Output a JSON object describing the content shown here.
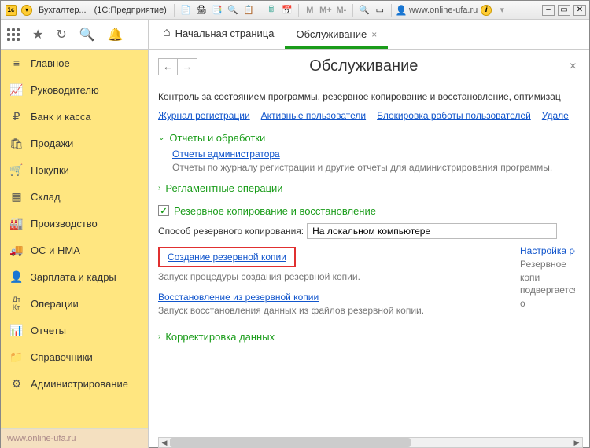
{
  "titlebar": {
    "app_title": "Бухгалтер...",
    "product": "(1С:Предприятие)",
    "url": "www.online-ufa.ru",
    "m_icons": [
      "M",
      "M+",
      "M-"
    ]
  },
  "tabs": {
    "home_label": "Начальная страница",
    "active_label": "Обслуживание"
  },
  "sidebar": {
    "items": [
      "Главное",
      "Руководителю",
      "Банк и касса",
      "Продажи",
      "Покупки",
      "Склад",
      "Производство",
      "ОС и НМА",
      "Зарплата и кадры",
      "Операции",
      "Отчеты",
      "Справочники",
      "Администрирование"
    ],
    "footer": "www.online-ufa.ru"
  },
  "page": {
    "title": "Обслуживание",
    "description": "Контроль за состоянием программы, резервное копирование и восстановление, оптимизац",
    "quick_links": [
      "Журнал регистрации",
      "Активные пользователи",
      "Блокировка работы пользователей",
      "Удале"
    ],
    "sections": {
      "reports": {
        "title": "Отчеты и обработки",
        "link": "Отчеты администратора",
        "desc": "Отчеты по журналу регистрации и другие отчеты для администрирования программы."
      },
      "scheduled": {
        "title": "Регламентные операции"
      },
      "backup": {
        "title": "Резервное копирование и восстановление",
        "method_label": "Способ резервного копирования:",
        "method_value": "На локальном компьютере",
        "create_link": "Создание резервной копии",
        "create_desc": "Запуск процедуры создания резервной копии.",
        "restore_link": "Восстановление из резервной копии",
        "restore_desc": "Запуск восстановления данных из файлов резервной копии.",
        "settings_link": "Настройка резе",
        "settings_desc": "Резервное копи подвергается о"
      },
      "correction": {
        "title": "Корректировка данных"
      }
    }
  }
}
